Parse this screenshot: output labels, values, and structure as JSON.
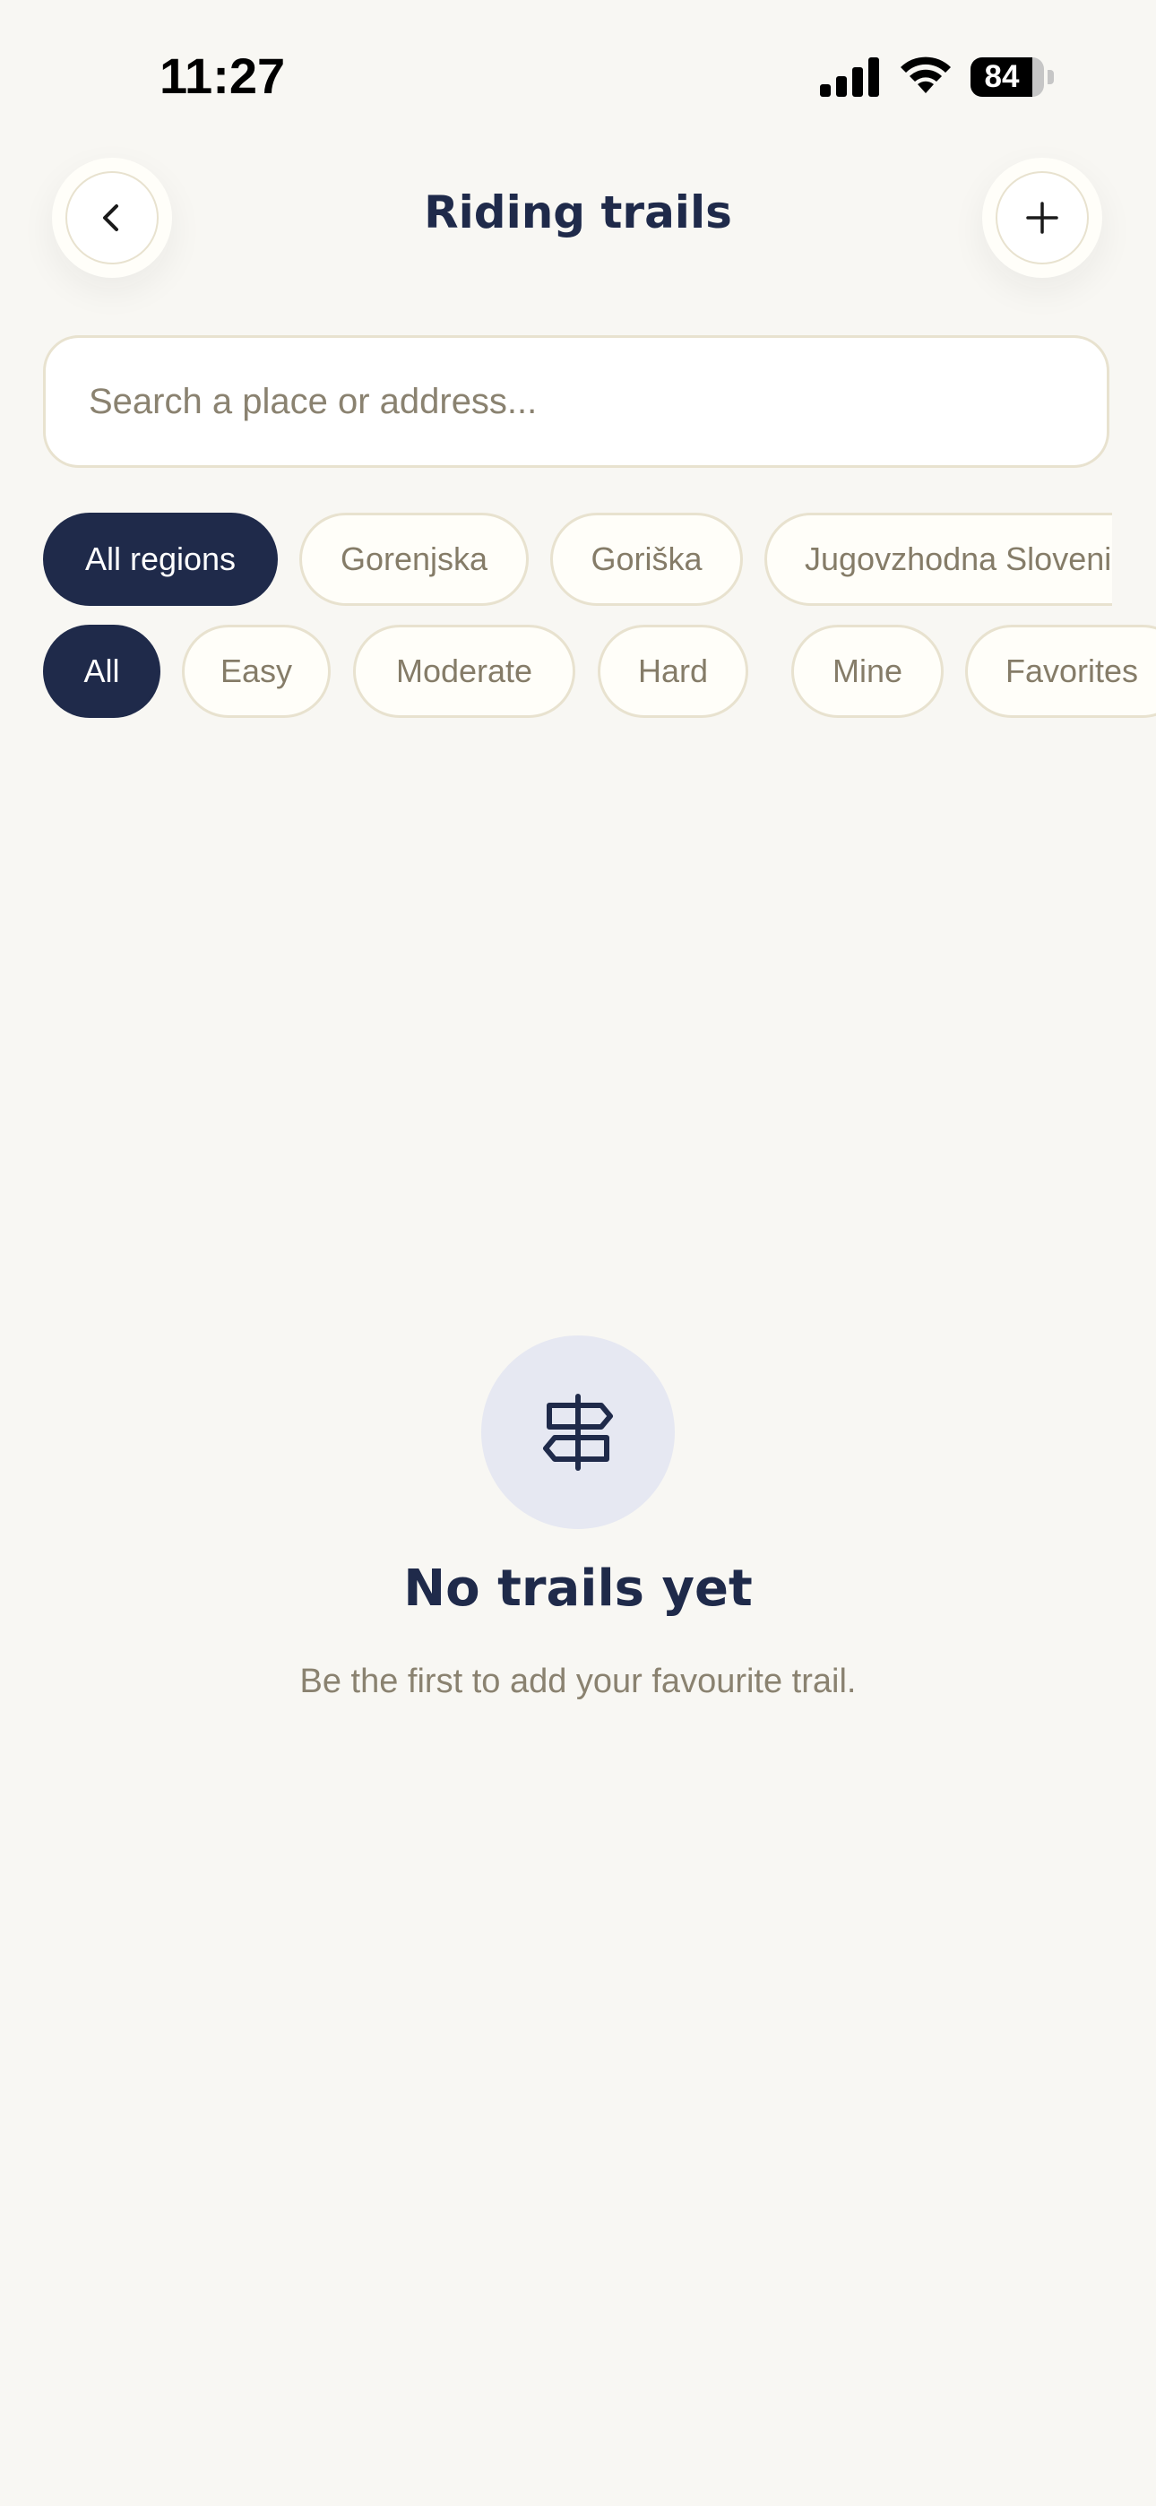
{
  "status_bar": {
    "time": "11:27",
    "battery_level": "84",
    "battery_fraction": 0.84,
    "icons": [
      "signal-icon",
      "wifi-icon",
      "battery-icon"
    ]
  },
  "header": {
    "title": "Riding trails",
    "back_icon": "chevron-left-icon",
    "add_icon": "plus-icon"
  },
  "search": {
    "placeholder": "Search a place or address...",
    "value": ""
  },
  "region_filters": {
    "items": [
      {
        "label": "All regions",
        "active": true
      },
      {
        "label": "Gorenjska",
        "active": false
      },
      {
        "label": "Goriška",
        "active": false
      },
      {
        "label": "Jugovzhodna Sloveni",
        "active": false
      }
    ]
  },
  "difficulty_filters": {
    "items": [
      {
        "label": "All",
        "active": true
      },
      {
        "label": "Easy",
        "active": false
      },
      {
        "label": "Moderate",
        "active": false
      },
      {
        "label": "Hard",
        "active": false
      },
      {
        "label": "Mine",
        "active": false
      },
      {
        "label": "Favorites",
        "active": false
      }
    ]
  },
  "empty_state": {
    "icon": "signpost-icon",
    "title": "No trails yet",
    "subtitle": "Be the first to add your favourite trail."
  },
  "colors": {
    "background": "#f8f7f3",
    "primary": "#1f2a4a",
    "chip_border": "#e8e2cf",
    "muted_text": "#8a8270",
    "icon_circle": "#e6e8f2"
  }
}
